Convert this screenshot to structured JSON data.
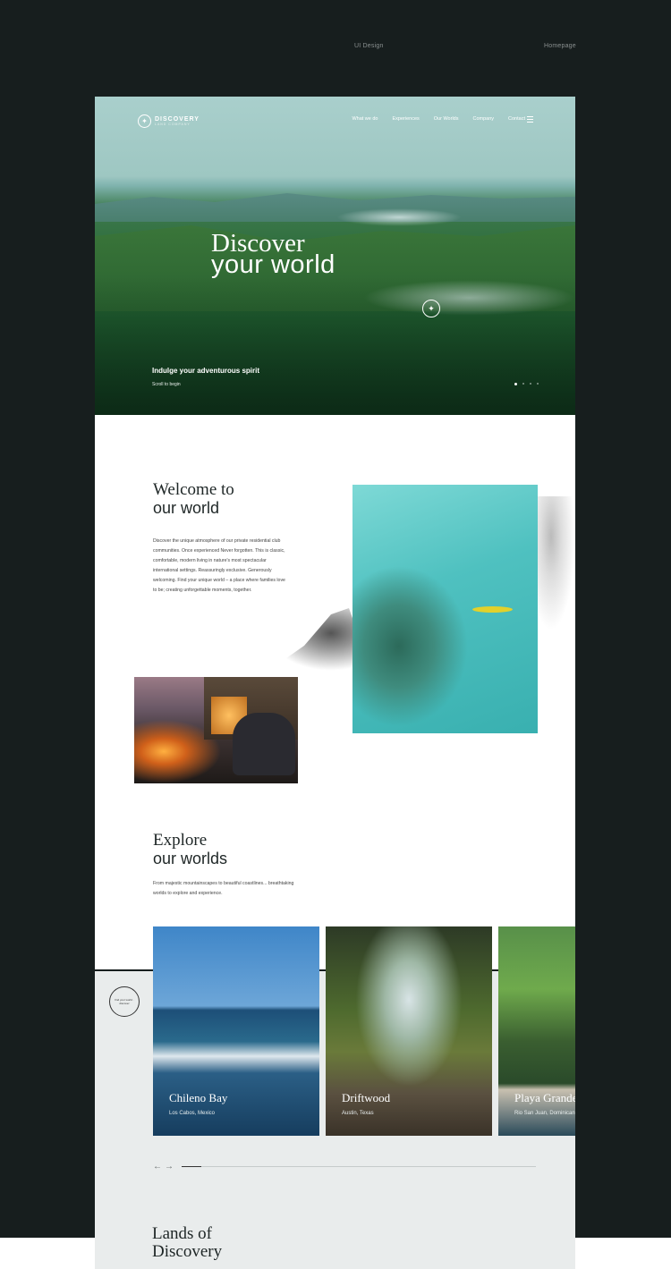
{
  "meta": {
    "left_label": "UI Design",
    "right_label": "Homepage"
  },
  "header": {
    "logo_name": "DISCOVERY",
    "logo_sub": "LAND COMPANY",
    "nav": [
      "What we do",
      "Experiences",
      "Our Worlds",
      "Company",
      "Contact"
    ]
  },
  "hero": {
    "title_line1": "Discover",
    "title_line2": "your world",
    "tagline": "Indulge your adventurous spirit",
    "scroll": "Scroll to begin"
  },
  "welcome": {
    "title_line1": "Welcome to",
    "title_line2": "our world",
    "body": "Discover the unique atmosphere of our private residential club communities. Once experienced Never forgotten. This is classic, comfortable, modern living in nature's most spectacular international settings. Reassuringly exclusive. Generously welcoming. Find your unique world – a place where families love to be; creating unforgettable moments, together."
  },
  "explore": {
    "title_line1": "Explore",
    "title_line2": "our worlds",
    "body": "From majestic mountainscapes to beautiful coastlines... breathtaking worlds to explore and experience.",
    "badge": "find your world · discover"
  },
  "worlds": [
    {
      "name": "Chileno Bay",
      "location": "Los Cabos, Mexico"
    },
    {
      "name": "Driftwood",
      "location": "Austin, Texas"
    },
    {
      "name": "Playa Grande",
      "location": "Rio San Juan, Dominican"
    }
  ],
  "carousel": {
    "arrows": "←→"
  },
  "lands": {
    "title_line1": "Lands of",
    "title_line2": "Discovery"
  }
}
